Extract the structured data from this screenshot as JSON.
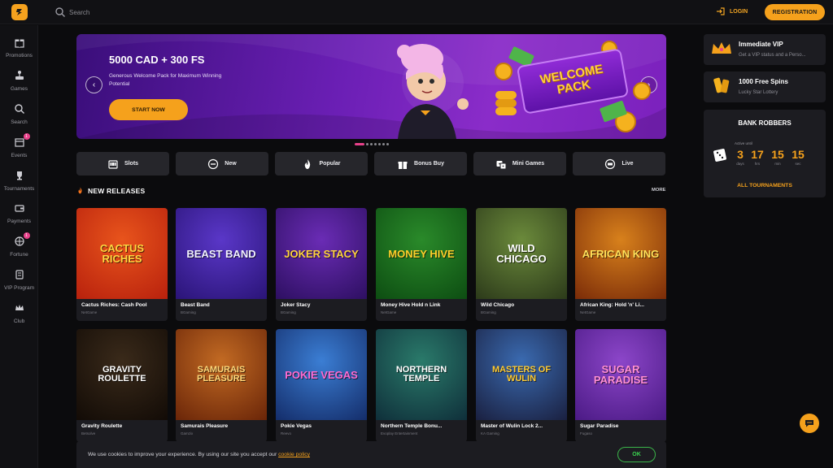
{
  "header": {
    "search_placeholder": "Search",
    "login_label": "LOGIN",
    "register_label": "REGISTRATION"
  },
  "sidebar": {
    "items": [
      {
        "label": "Promotions",
        "icon": "gift-icon"
      },
      {
        "label": "Games",
        "icon": "joystick-icon"
      },
      {
        "label": "Search",
        "icon": "search-icon"
      },
      {
        "label": "Events",
        "icon": "calendar-icon",
        "badge": "1"
      },
      {
        "label": "Tournaments",
        "icon": "trophy-icon"
      },
      {
        "label": "Payments",
        "icon": "wallet-icon"
      },
      {
        "label": "Fortune",
        "icon": "wheel-icon",
        "badge": "1"
      },
      {
        "label": "VIP Program",
        "icon": "vip-icon"
      },
      {
        "label": "Club",
        "icon": "crown-icon"
      }
    ]
  },
  "hero": {
    "title": "5000 CAD + 300 FS",
    "subtitle": "Generous Welcome Pack for Maximum Winning Potential",
    "cta": "START NOW",
    "badge_line1": "WELCOME",
    "badge_line2": "PACK",
    "slides": 7,
    "active_slide": 1
  },
  "categories": [
    {
      "label": "Slots",
      "icon": "slot-machine-icon"
    },
    {
      "label": "New",
      "icon": "new-icon"
    },
    {
      "label": "Popular",
      "icon": "flame-icon"
    },
    {
      "label": "Bonus Buy",
      "icon": "gift-box-icon"
    },
    {
      "label": "Mini Games",
      "icon": "dice-icon"
    },
    {
      "label": "Live",
      "icon": "live-icon"
    }
  ],
  "new_releases": {
    "title": "NEW RELEASES",
    "more": "MORE",
    "games": [
      {
        "name": "Cactus Riches: Cash Pool",
        "provider": "NetGame",
        "art": "CACTUS RICHES",
        "bg1": "#e8541c",
        "bg2": "#b8210d",
        "fg": "#ffd640"
      },
      {
        "name": "Beast Band",
        "provider": "BGaming",
        "art": "BEAST BAND",
        "bg1": "#5a37c8",
        "bg2": "#2a1477",
        "fg": "#f3f3ff"
      },
      {
        "name": "Joker Stacy",
        "provider": "BGaming",
        "art": "JOKER STACY",
        "bg1": "#6a2cb5",
        "bg2": "#2d0f61",
        "fg": "#ffd33d"
      },
      {
        "name": "Money Hive Hold n Link",
        "provider": "NetGame",
        "art": "MONEY HIVE",
        "bg1": "#2a8a2a",
        "bg2": "#0d4d12",
        "fg": "#ffcf2a"
      },
      {
        "name": "Wild Chicago",
        "provider": "BGaming",
        "art": "WILD CHICAGO",
        "bg1": "#6b8a3b",
        "bg2": "#2c3a1a",
        "fg": "#ffffff"
      },
      {
        "name": "African King: Hold 'n' Li...",
        "provider": "NetGame",
        "art": "AFRICAN KING",
        "bg1": "#d8811c",
        "bg2": "#7a2b08",
        "fg": "#ffe15a"
      },
      {
        "name": "Gravity Roulette",
        "provider": "Betsolve",
        "art": "GRAVITY ROULETTE",
        "bg1": "#3a2a1a",
        "bg2": "#120b06",
        "fg": "#ffffff"
      },
      {
        "name": "Samurais Pleasure",
        "provider": "Gamzix",
        "art": "SAMURAIS PLEASURE",
        "bg1": "#c26a23",
        "bg2": "#6a2508",
        "fg": "#ffd87a"
      },
      {
        "name": "Pokie Vegas",
        "provider": "Reevo",
        "art": "POKIE VEGAS",
        "bg1": "#3b7ed4",
        "bg2": "#142d6a",
        "fg": "#ff6bd1"
      },
      {
        "name": "Northern Temple Bonu...",
        "provider": "Evoplay Entertainment",
        "art": "NORTHERN TEMPLE",
        "bg1": "#2a7a6a",
        "bg2": "#0f2f3a",
        "fg": "#ffffff"
      },
      {
        "name": "Master of Wulin Lock 2...",
        "provider": "KA Gaming",
        "art": "MASTERS OF WULIN",
        "bg1": "#3a6ab0",
        "bg2": "#1a2040",
        "fg": "#ffcc33"
      },
      {
        "name": "Sugar Paradise",
        "provider": "Fugaso",
        "art": "SUGAR PARADISE",
        "bg1": "#8c46c9",
        "bg2": "#4b1a85",
        "fg": "#ff8fd1"
      }
    ]
  },
  "right_panel": {
    "vip": {
      "title": "Immediate VIP",
      "subtitle": "Get a VIP status and a Perso..."
    },
    "spins": {
      "title": "1000 Free Spins",
      "subtitle": "Lucky Star Lottery"
    },
    "tournament": {
      "title": "BANK ROBBERS",
      "active_until": "Active until",
      "days": "3",
      "hrs": "17",
      "min": "15",
      "sec": "15",
      "days_label": "days",
      "hrs_label": "hrs",
      "min_label": "min",
      "sec_label": "sec",
      "all_link": "ALL TOURNAMENTS"
    }
  },
  "cookie": {
    "text": "We use cookies to improve your experience. By using our site you accept our ",
    "link": "cookie policy",
    "ok": "OK"
  },
  "colors": {
    "accent": "#f5a11c",
    "background": "#0b0b0d",
    "panel": "#1c1c21",
    "hero_purple": "#6b1fb5",
    "ok_green": "#3bd44f"
  }
}
